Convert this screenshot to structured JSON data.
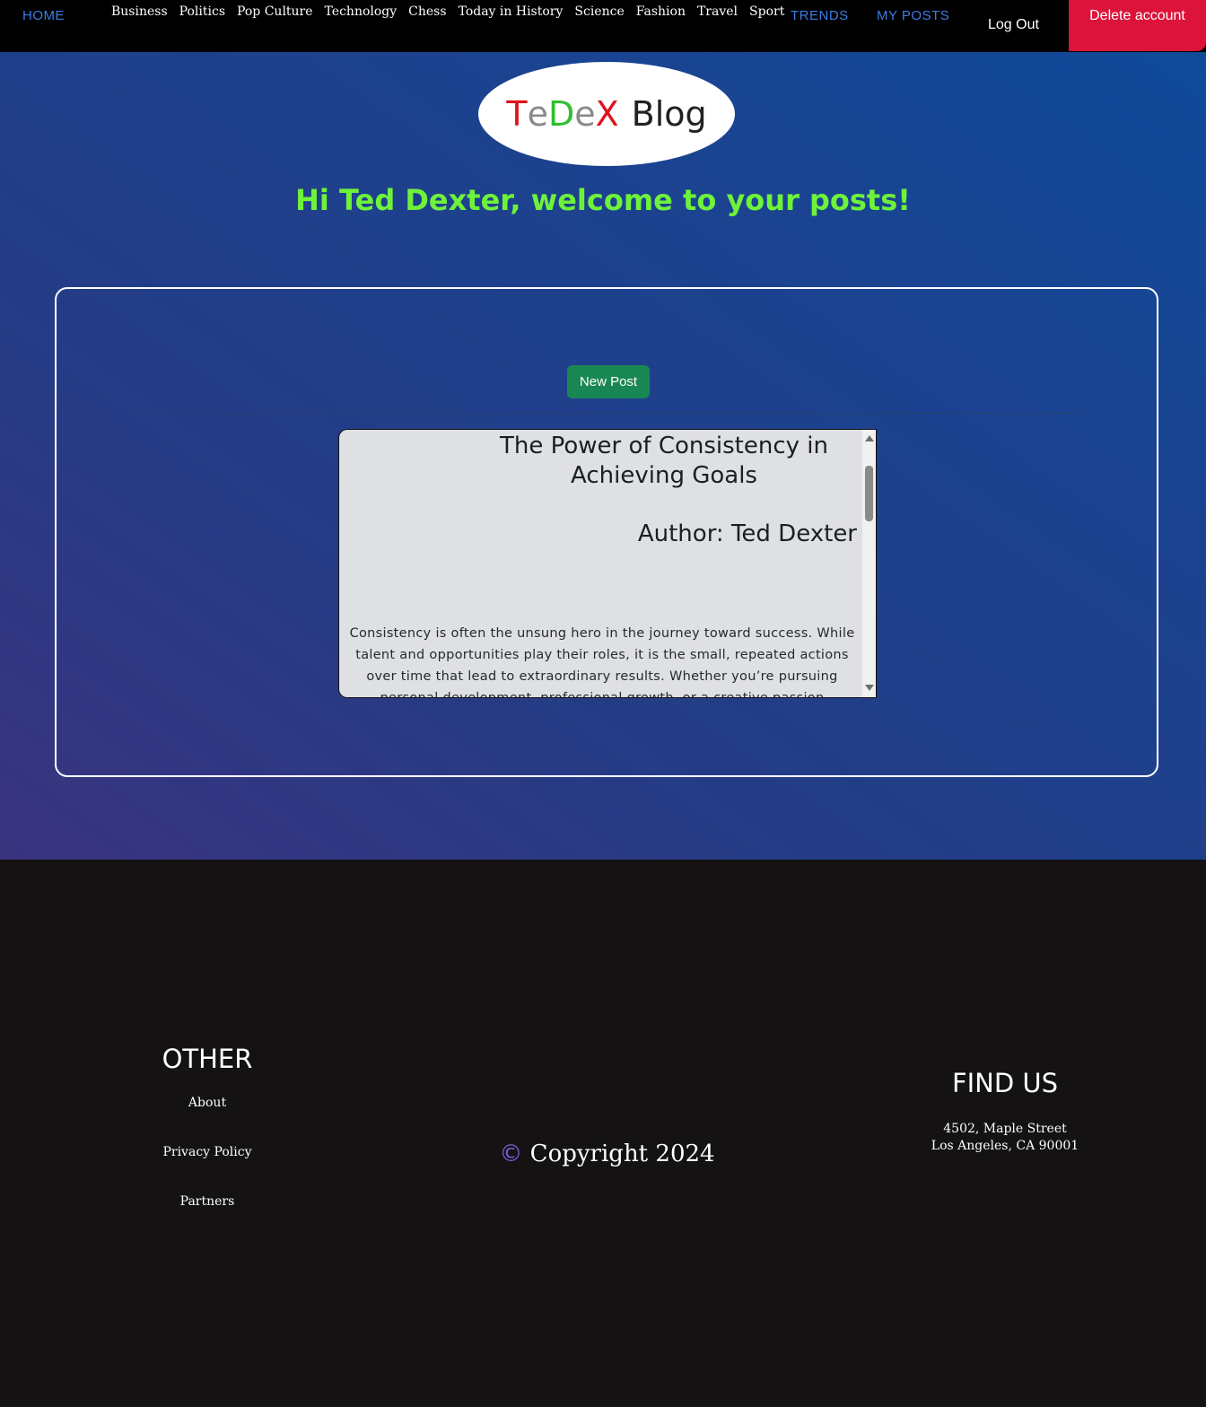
{
  "nav": {
    "home": "HOME",
    "categories": [
      "Business",
      "Politics",
      "Pop Culture",
      "Technology",
      "Chess",
      "Today in History",
      "Science",
      "Fashion",
      "Travel",
      "Sport"
    ],
    "trends": "TRENDS",
    "my_posts": "MY POSTS",
    "logout": "Log Out",
    "delete_account": "Delete account"
  },
  "logo": {
    "letters": [
      {
        "char": "T",
        "color": "#e0121b"
      },
      {
        "char": "e",
        "color": "#8a8a8a"
      },
      {
        "char": "D",
        "color": "#2fbf2f"
      },
      {
        "char": "e",
        "color": "#8a8a8a"
      },
      {
        "char": "X",
        "color": "#e0121b"
      }
    ],
    "suffix": "Blog"
  },
  "welcome": "Hi Ted Dexter, welcome to your posts!",
  "panel": {
    "new_post_label": "New Post"
  },
  "post": {
    "title": "The Power of Consistency in Achieving Goals",
    "author": "Author: Ted Dexter",
    "body": "Consistency is often the unsung hero in the journey toward success. While talent and opportunities play their roles, it is the small, repeated actions over time that lead to extraordinary results. Whether you’re pursuing personal development, professional growth, or a creative passion"
  },
  "footer": {
    "other_title": "OTHER",
    "links": [
      "About",
      "Privacy Policy",
      "Partners"
    ],
    "copyright_symbol": "©",
    "copyright_text": "Copyright 2024",
    "find_title": "FIND US",
    "address_line1": "4502, Maple Street",
    "address_line2": "Los Angeles, CA 90001"
  },
  "colors": {
    "accent_blue": "#3d7de6",
    "delete_red": "#dc143c",
    "welcome_green": "#6ef23a",
    "new_post_green": "#198754"
  }
}
